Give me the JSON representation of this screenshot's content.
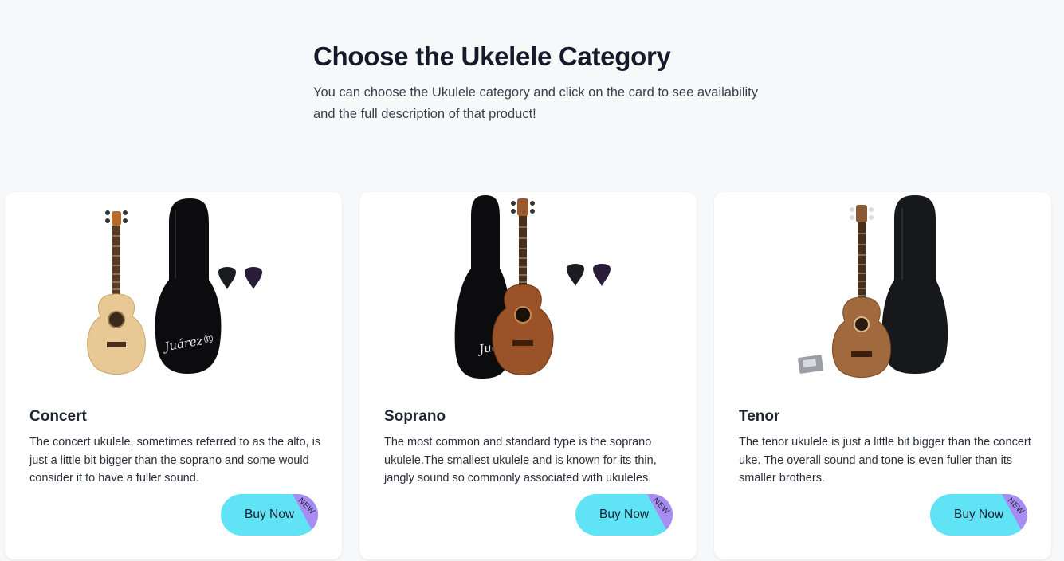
{
  "header": {
    "title": "Choose the Ukelele Category",
    "subtitle": "You can choose the Ukulele category and click on the card to see availability and the full description of that product!"
  },
  "cards": [
    {
      "title": "Concert",
      "description": "The concert ukulele, sometimes referred to as the alto, is just a little bit bigger than the soprano and some would consider it to have a fuller sound.",
      "button_label": "Buy Now",
      "badge": "NEW",
      "case_brand": "Juárez®"
    },
    {
      "title": "Soprano",
      "description": "The most common and standard type is the soprano ukulele.The smallest ukulele and is known for its thin, jangly sound so commonly associated with ukuleles.",
      "button_label": "Buy Now",
      "badge": "NEW",
      "case_brand": "Juár"
    },
    {
      "title": "Tenor",
      "description": "The tenor ukulele is just a little bit bigger than the concert uke. The overall sound and tone is even fuller than its smaller brothers.",
      "button_label": "Buy Now",
      "badge": "NEW"
    }
  ],
  "colors": {
    "background": "#f7f8fa",
    "card": "#ffffff",
    "button": "#5fe3f5",
    "badge": "#a88cf2"
  }
}
